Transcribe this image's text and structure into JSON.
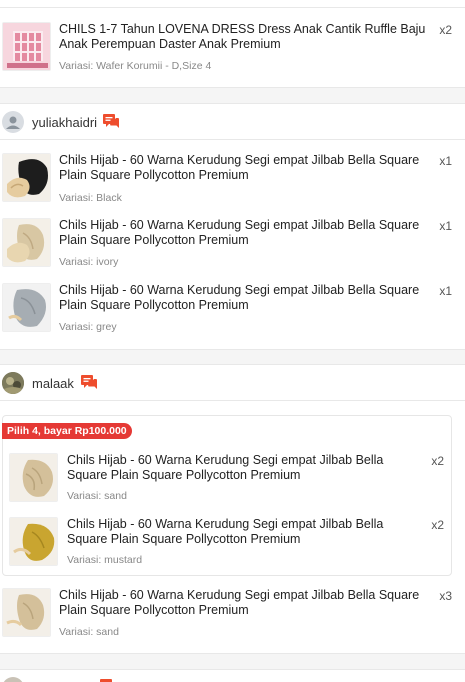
{
  "orders": [
    {
      "items": [
        {
          "title": "CHILS 1-7 Tahun LOVENA DRESS Dress Anak Cantik Ruffle Baju Anak Perempuan Daster Anak Premium",
          "variant": "Variasi: Wafer Korumii - D,Size 4",
          "qty": "x2"
        }
      ]
    },
    {
      "shop": "yuliakhaidri",
      "items": [
        {
          "title": "Chils Hijab - 60 Warna Kerudung Segi empat Jilbab Bella Square Plain Square Pollycotton Premium",
          "variant": "Variasi: Black",
          "qty": "x1"
        },
        {
          "title": "Chils Hijab - 60 Warna Kerudung Segi empat Jilbab Bella Square Plain Square Pollycotton Premium",
          "variant": "Variasi: ivory",
          "qty": "x1"
        },
        {
          "title": "Chils Hijab - 60 Warna Kerudung Segi empat Jilbab Bella Square Plain Square Pollycotton Premium",
          "variant": "Variasi: grey",
          "qty": "x1"
        }
      ]
    },
    {
      "shop": "malaak",
      "promo": "Pilih 4, bayar Rp100.000",
      "bundle_items": [
        {
          "title": "Chils Hijab - 60 Warna Kerudung Segi empat Jilbab Bella Square Plain Square Pollycotton Premium",
          "variant": "Variasi: sand",
          "qty": "x2"
        },
        {
          "title": "Chils Hijab - 60 Warna Kerudung Segi empat Jilbab Bella Square Plain Square Pollycotton Premium",
          "variant": "Variasi: mustard",
          "qty": "x2"
        }
      ],
      "items": [
        {
          "title": "Chils Hijab - 60 Warna Kerudung Segi empat Jilbab Bella Square Plain Square Pollycotton Premium",
          "variant": "Variasi: sand",
          "qty": "x3"
        }
      ]
    }
  ],
  "colors": {
    "chat_icon": "#ee4d2d",
    "promo_bg": "#e53935"
  }
}
